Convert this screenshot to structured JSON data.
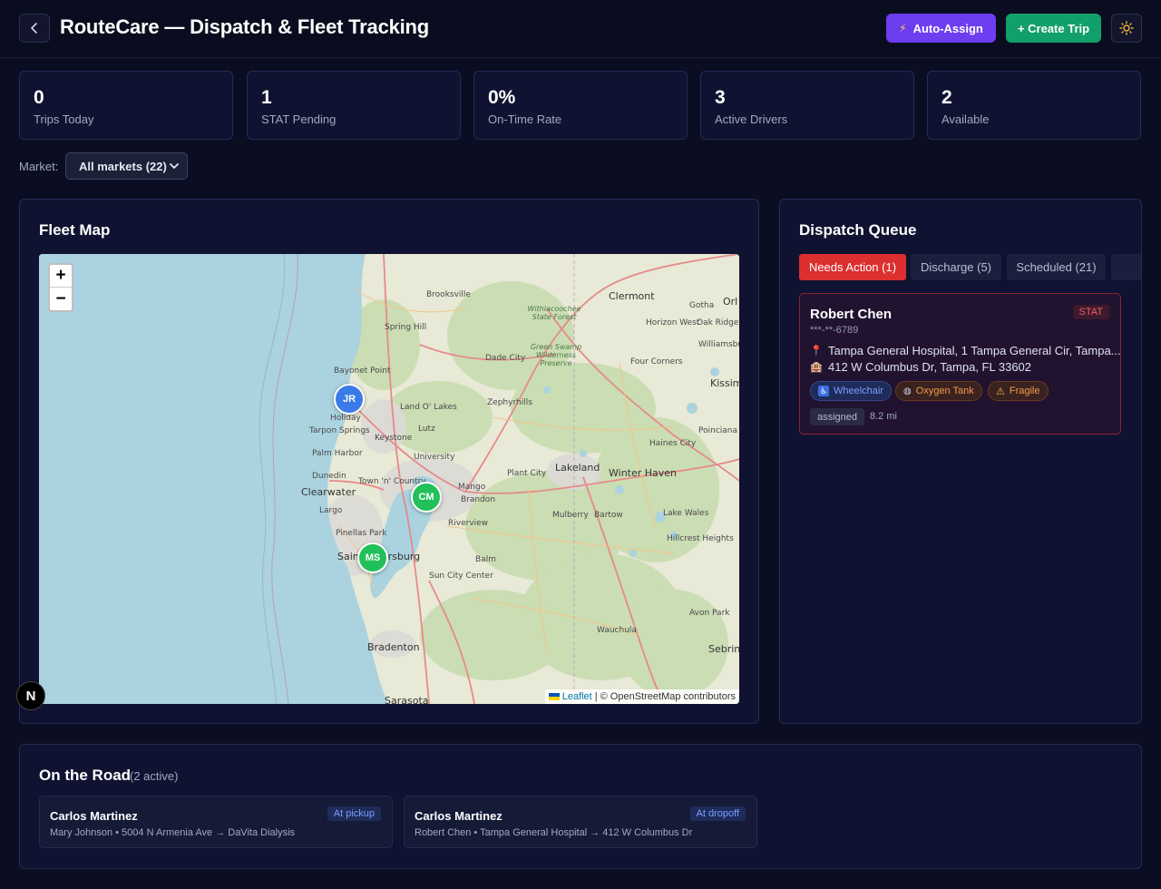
{
  "header": {
    "title": "RouteCare — Dispatch & Fleet Tracking",
    "auto_assign_label": "Auto-Assign",
    "create_trip_label": "+ Create Trip"
  },
  "stats": [
    {
      "value": "0",
      "label": "Trips Today"
    },
    {
      "value": "1",
      "label": "STAT Pending"
    },
    {
      "value": "0%",
      "label": "On-Time Rate"
    },
    {
      "value": "3",
      "label": "Active Drivers"
    },
    {
      "value": "2",
      "label": "Available"
    }
  ],
  "market": {
    "label": "Market:",
    "selected": "All markets (22)"
  },
  "fleet_map": {
    "title": "Fleet Map",
    "zoom_in": "+",
    "zoom_out": "−",
    "attribution_link": "Leaflet",
    "attribution_text": "| © OpenStreetMap contributors",
    "markers": [
      "JR",
      "CM",
      "MS"
    ],
    "marker_colors": {
      "JR": "#3b7be8",
      "CM": "#22c05a",
      "MS": "#22c05a"
    },
    "place_labels": {
      "brooksville": "Brooksville",
      "clermont": "Clermont",
      "orl": "Orl",
      "spring_hill": "Spring Hill",
      "horizon_west": "Horizon West",
      "gotha": "Gotha",
      "oak_ridge": "Oak Ridge",
      "williamsbu": "Williamsbu",
      "withlacoochee": "Withlacoochee State Forest",
      "green_swamp": "Green Swamp Wilderness Preserve",
      "dade_city": "Dade City",
      "four_corners": "Four Corners",
      "kissim": "Kissim",
      "bayonet_point": "Bayonet Point",
      "land_o_lakes": "Land O' Lakes",
      "zephyrhills": "Zephyrhills",
      "holiday": "Holiday",
      "tarpon_springs": "Tarpon Springs",
      "keystone": "Keystone",
      "lutz": "Lutz",
      "haines_city": "Haines City",
      "poinciana": "Poinciana",
      "palm_harbor": "Palm Harbor",
      "university": "University",
      "dunedin": "Dunedin",
      "town_n_country": "Town 'n' Country",
      "plant_city": "Plant City",
      "lakeland": "Lakeland",
      "winter_haven": "Winter Haven",
      "clearwater": "Clearwater",
      "mango": "Mango",
      "brandon": "Brandon",
      "largo": "Largo",
      "mulberry": "Mulberry",
      "bartow": "Bartow",
      "lake_wales": "Lake Wales",
      "riverview": "Riverview",
      "pinellas_park": "Pinellas Park",
      "hillcrest_heights": "Hillcrest Heights",
      "saint_petersburg": "Saint Petersburg",
      "balm": "Balm",
      "sun_city_center": "Sun City Center",
      "avon_park": "Avon Park",
      "wauchula": "Wauchula",
      "bradenton": "Bradenton",
      "sebrin": "Sebrin",
      "sarasota": "Sarasota"
    }
  },
  "dispatch_queue": {
    "title": "Dispatch Queue",
    "tabs": [
      {
        "label": "Needs Action (1)",
        "active": true
      },
      {
        "label": "Discharge (5)",
        "active": false
      },
      {
        "label": "Scheduled (21)",
        "active": false
      }
    ],
    "card": {
      "name": "Robert Chen",
      "ssn": "***-**-6789",
      "priority": "STAT",
      "pickup": "Tampa General Hospital, 1 Tampa General Cir, Tampa...",
      "dropoff": "412 W Columbus Dr, Tampa, FL 33602",
      "tags": {
        "wheelchair": "Wheelchair",
        "oxygen": "Oxygen Tank",
        "fragile": "Fragile"
      },
      "status": "assigned",
      "distance": "8.2 mi"
    }
  },
  "on_the_road": {
    "title": "On the Road",
    "count": "(2 active)",
    "trips": [
      {
        "driver": "Carlos Martinez",
        "status": "At pickup",
        "detail": "Mary Johnson • 5004 N Armenia Ave → DaVita Dialysis"
      },
      {
        "driver": "Carlos Martinez",
        "status": "At dropoff",
        "detail": "Robert Chen • Tampa General Hospital → 412 W Columbus Dr"
      }
    ]
  },
  "floating_badge": "N",
  "colors": {
    "background": "#0b0e22",
    "auto_assign": "#6d3df0",
    "create_trip": "#12a06a",
    "needs_action": "#dc2f2f",
    "stat_border": "#8a2530"
  }
}
